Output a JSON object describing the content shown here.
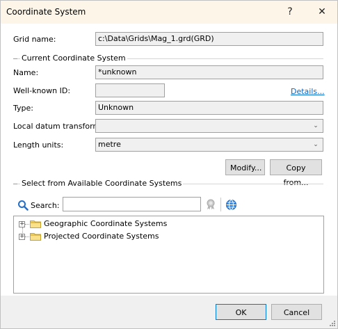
{
  "window": {
    "title": "Coordinate System"
  },
  "titlebar": {
    "help_glyph": "?",
    "close_glyph": "✕"
  },
  "grid": {
    "label": "Grid name:",
    "value": "c:\\Data\\Grids\\Mag_1.grd(GRD)"
  },
  "current": {
    "section_title": "Current Coordinate System",
    "name_label": "Name:",
    "name_value": "*unknown",
    "wkid_label": "Well-known ID:",
    "wkid_value": "",
    "details_link": "Details...",
    "type_label": "Type:",
    "type_value": "Unknown",
    "datum_label": "Local datum transform:",
    "datum_value": "",
    "length_label": "Length units:",
    "length_value": "metre",
    "modify_button": "Modify...",
    "copy_button": "Copy from..."
  },
  "available": {
    "section_title": "Select from Available Coordinate Systems",
    "search_label": "Search:",
    "search_value": "",
    "tree": [
      {
        "label": "Geographic Coordinate Systems"
      },
      {
        "label": "Projected Coordinate Systems"
      }
    ]
  },
  "footer": {
    "ok_button": "OK",
    "cancel_button": "Cancel"
  },
  "icons": {
    "search": "search-icon",
    "certificate": "certificate-icon",
    "globe": "globe-icon",
    "folder": "folder-icon",
    "expander": "expand-plus-icon",
    "dropdown": "chevron-down-icon"
  },
  "colors": {
    "titlebar_bg": "#fdf6e8",
    "link": "#0066cc",
    "accent": "#0078d7",
    "folder": "#f5d76e"
  }
}
